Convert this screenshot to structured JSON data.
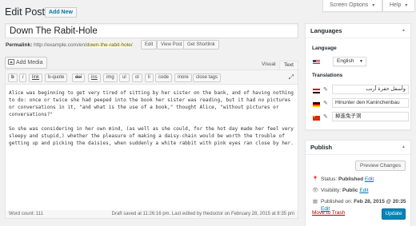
{
  "screen_options": {
    "label": "Screen Options"
  },
  "help": {
    "label": "Help"
  },
  "page": {
    "title": "Edit Post",
    "add_new": "Add New"
  },
  "post": {
    "title": "Down The Rabit-Hole",
    "permalink_label": "Permalink:",
    "permalink_base": "http://example.com/en/",
    "permalink_slug": "down-the-rabit-hole",
    "permalink_trailing": "/",
    "edit_btn": "Edit",
    "view_btn": "View Post",
    "shortlink_btn": "Get Shortlink"
  },
  "editor": {
    "add_media": "Add Media",
    "tab_visual": "Visual",
    "tab_text": "Text",
    "toolbar": [
      "b",
      "i",
      "link",
      "b-quote",
      "del",
      "ins",
      "img",
      "ul",
      "ol",
      "li",
      "code",
      "more",
      "close tags"
    ],
    "paragraphs": [
      "Alice was beginning to get very tired of sitting by her sister on the bank, and of having nothing to do: once or twice she had peeped into the book her sister was reading, but it had no pictures or conversations in it, \"and what is the use of a book,\" thought Alice, \"without pictures or conversations?\"",
      "So she was considering in her own mind, (as well as she could, for the hot day made her feel very sleepy and stupid,) whether the pleasure of making a daisy-chain would be worth the trouble of getting up and picking the daisies, when suddenly a white rabbit with pink eyes ran close by her."
    ],
    "word_count": "Word count: 111",
    "draft_status": "Draft saved at 11:26:16 pm. Last edited by thedoctor on February 28, 2015 at 8:35 pm"
  },
  "languages": {
    "title": "Languages",
    "language_label": "Language",
    "selected_language": "English",
    "translations_label": "Translations",
    "translations": [
      {
        "flag": "egypt",
        "value": "وأسفل حفرة أرنب"
      },
      {
        "flag": "germany",
        "value": "Hinunter den Kaninchenbau"
      },
      {
        "flag": "china",
        "value": "掉進兔子洞"
      }
    ]
  },
  "publish": {
    "title": "Publish",
    "preview_btn": "Preview Changes",
    "status_label": "Status:",
    "status_value": "Published",
    "visibility_label": "Visibility:",
    "visibility_value": "Public",
    "published_label": "Published on:",
    "published_value": "Feb 28, 2015 @ 20:35",
    "edit_link": "Edit",
    "trash_link": "Move to Trash",
    "update_btn": "Update"
  },
  "colors": {
    "accent": "#0073aa",
    "primary_button": "#0085ba",
    "trash": "#a00000"
  }
}
